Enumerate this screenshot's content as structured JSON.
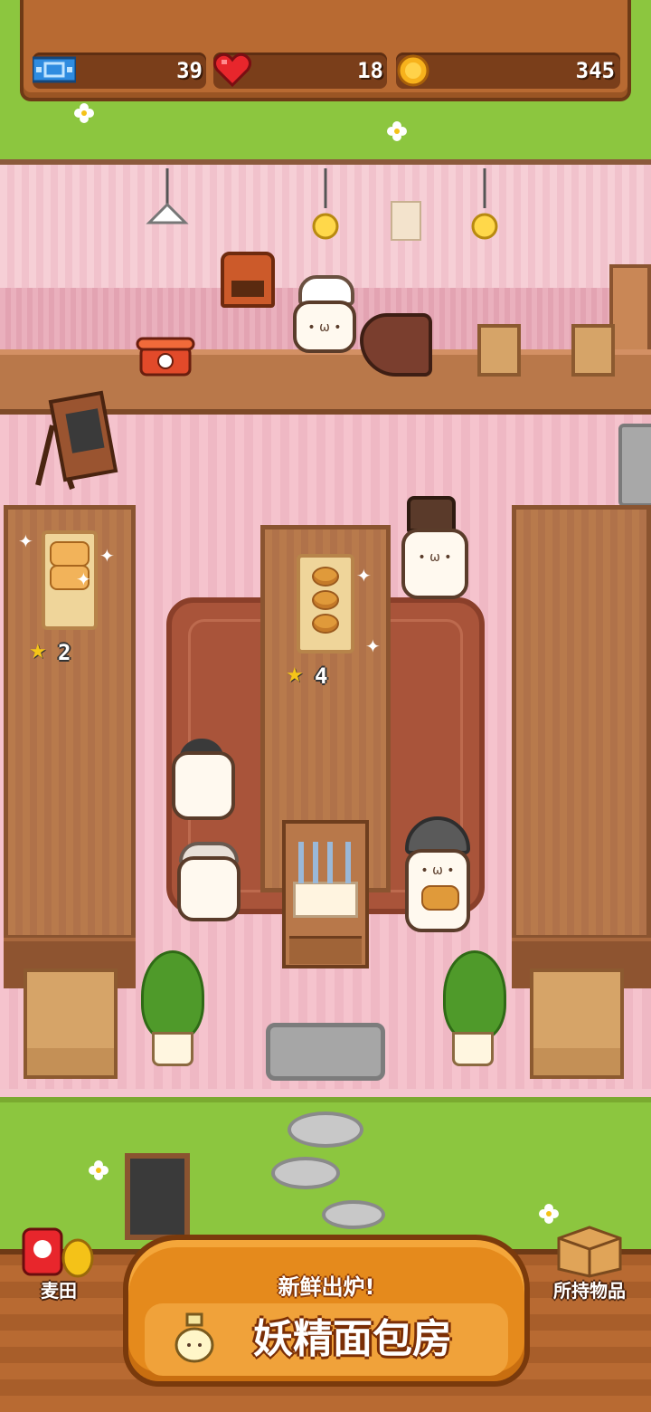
{
  "hud": {
    "tickets": "39",
    "hearts": "18",
    "coins": "345"
  },
  "shop": {
    "left_table_stars": "2",
    "center_table_stars": "4"
  },
  "bottom_bar": {
    "wheat_field_label": "麦田",
    "inventory_label": "所持物品",
    "subtitle": "新鲜出炉!",
    "title": "妖精面包房"
  },
  "colors": {
    "wood": "#b86a32",
    "grass": "#8cc63f",
    "floor_pink": "#f5c3cd",
    "rug": "#a9543a",
    "title_orange": "#e58a1c"
  }
}
